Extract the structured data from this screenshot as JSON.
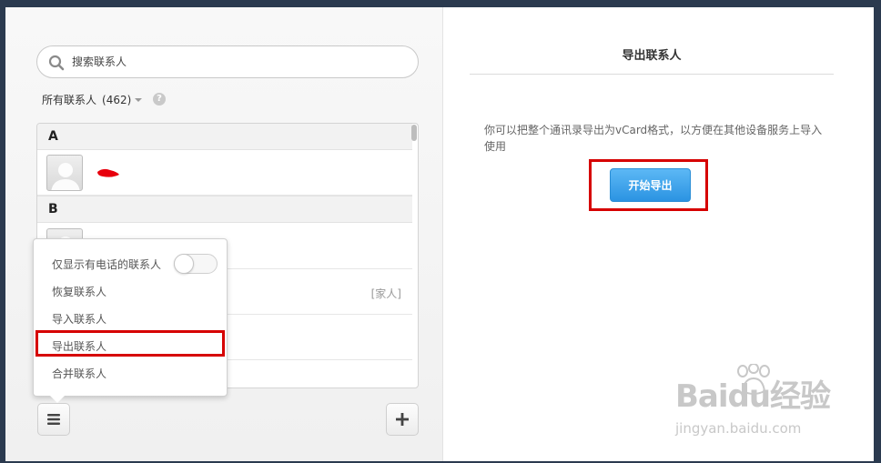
{
  "search": {
    "placeholder": "搜索联系人"
  },
  "filter": {
    "label": "所有联系人",
    "count": "(462)"
  },
  "help_symbol": "?",
  "list": {
    "sections": [
      {
        "letter": "A"
      },
      {
        "letter": "B"
      }
    ],
    "rows": [
      {
        "name": "",
        "tag": ""
      },
      {
        "name": "",
        "tag": ""
      },
      {
        "name": "",
        "tag": "[家人]"
      },
      {
        "name": "",
        "tag": ""
      }
    ]
  },
  "popup": {
    "items": [
      {
        "label": "仅显示有电话的联系人"
      },
      {
        "label": "恢复联系人"
      },
      {
        "label": "导入联系人"
      },
      {
        "label": "导出联系人"
      },
      {
        "label": "合并联系人"
      }
    ],
    "toggle_on": false
  },
  "right": {
    "title": "导出联系人",
    "description": "你可以把整个通讯录导出为vCard格式，以方便在其他设备服务上导入使用",
    "button": "开始导出"
  },
  "watermark": {
    "logo": "Baidu经验",
    "sub": "jingyan.baidu.com"
  },
  "colors": {
    "accent": "#2b93e2",
    "highlight": "#d60000"
  }
}
